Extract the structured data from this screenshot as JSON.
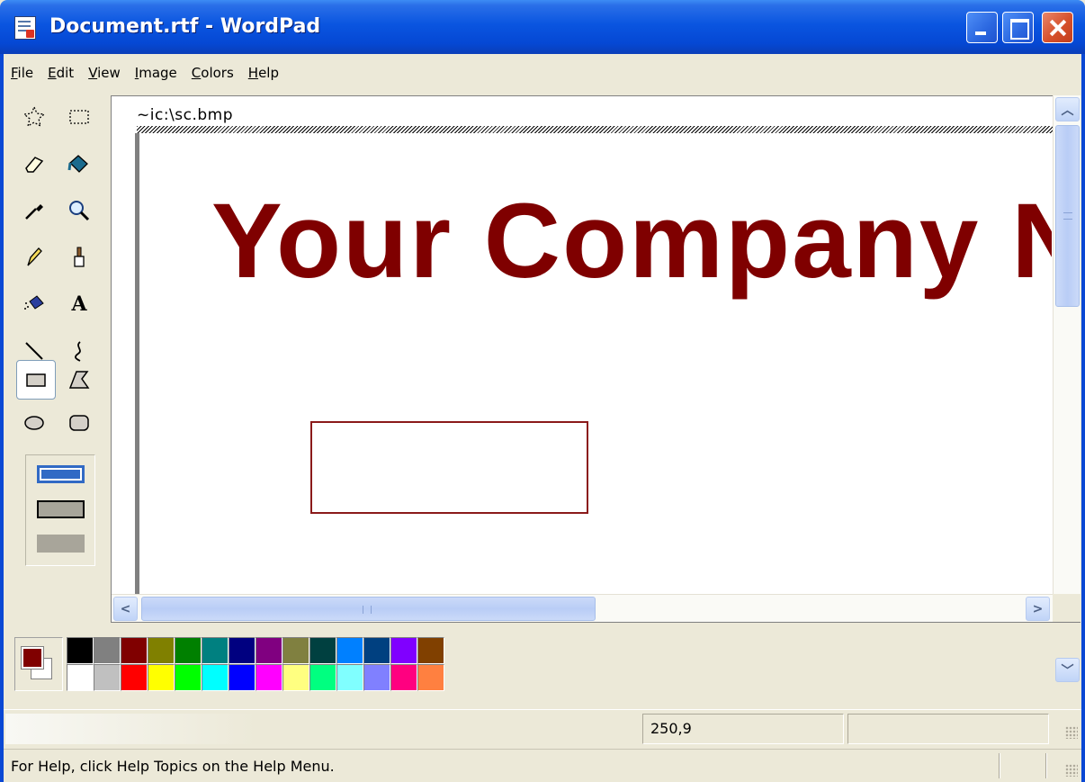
{
  "window": {
    "title": "Document.rtf - WordPad",
    "buttons": [
      "minimize",
      "maximize",
      "close"
    ]
  },
  "menu": [
    "File",
    "Edit",
    "View",
    "Image",
    "Colors",
    "Help"
  ],
  "tools": [
    {
      "name": "free-form-select-icon"
    },
    {
      "name": "select-icon"
    },
    {
      "name": "eraser-icon"
    },
    {
      "name": "fill-icon"
    },
    {
      "name": "pick-color-icon"
    },
    {
      "name": "magnifier-icon"
    },
    {
      "name": "pencil-icon"
    },
    {
      "name": "brush-icon"
    },
    {
      "name": "airbrush-icon"
    },
    {
      "name": "text-icon",
      "glyph": "A"
    },
    {
      "name": "line-icon"
    },
    {
      "name": "curve-icon"
    },
    {
      "name": "rectangle-icon",
      "selected": true
    },
    {
      "name": "polygon-icon"
    },
    {
      "name": "ellipse-icon"
    },
    {
      "name": "rounded-rectangle-icon"
    }
  ],
  "canvas": {
    "file_path": "~ic:\\sc.bmp",
    "big_text": "Your Company N",
    "text_color": "#7F0000",
    "rect_color": "#8B1A1A"
  },
  "palette": {
    "foreground": "#800000",
    "background": "#FFFFFF",
    "colors_row1": [
      "#000000",
      "#808080",
      "#800000",
      "#808000",
      "#008000",
      "#008080",
      "#000080",
      "#800080",
      "#808040",
      "#004040",
      "#0080FF",
      "#004080",
      "#8000FF",
      "#804000"
    ],
    "colors_row2": [
      "#FFFFFF",
      "#C0C0C0",
      "#FF0000",
      "#FFFF00",
      "#00FF00",
      "#00FFFF",
      "#0000FF",
      "#FF00FF",
      "#FFFF80",
      "#00FF80",
      "#80FFFF",
      "#8080FF",
      "#FF0080",
      "#FF8040"
    ]
  },
  "status": {
    "coords": "250,9",
    "help": "For Help, click Help Topics on the Help Menu."
  }
}
